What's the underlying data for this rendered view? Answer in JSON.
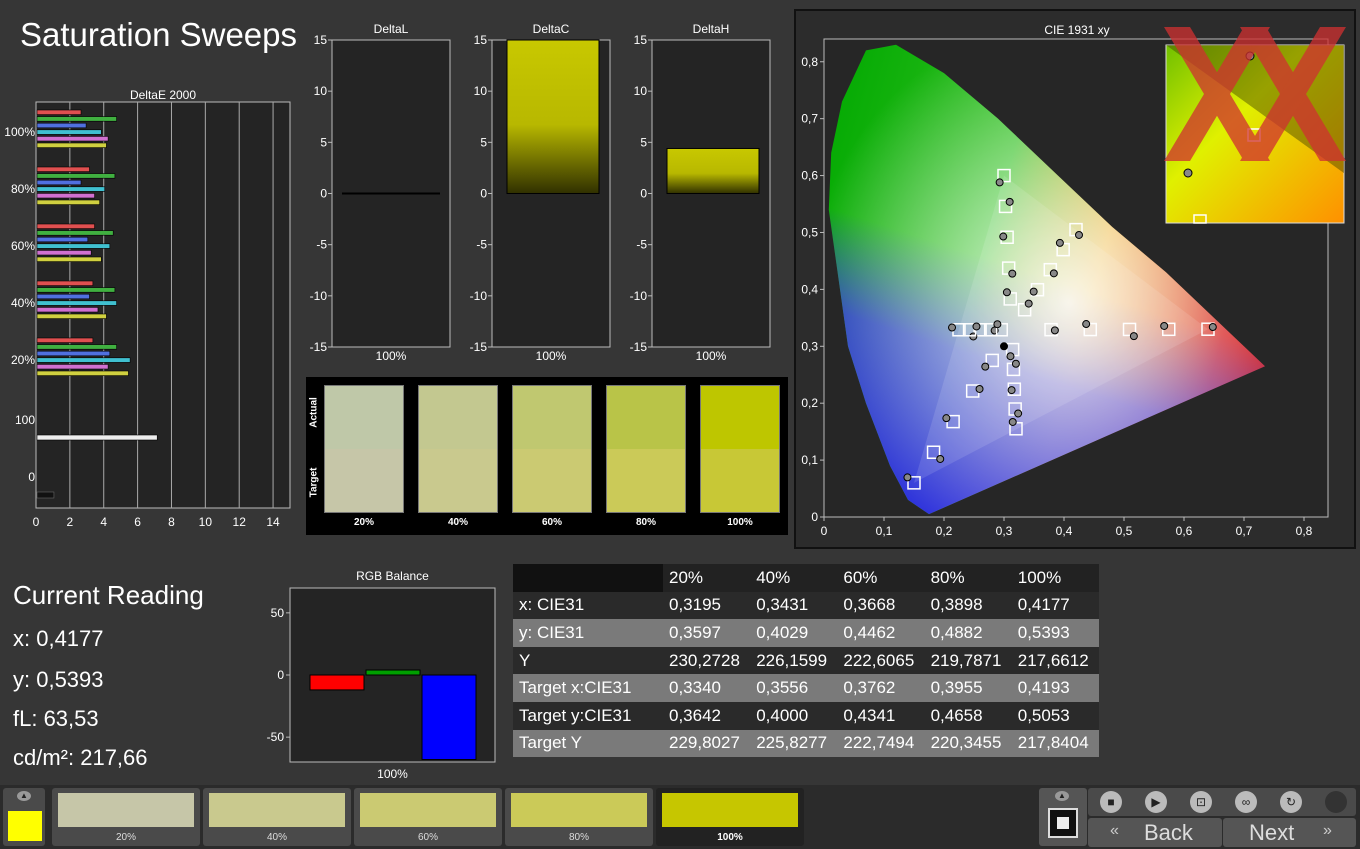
{
  "page_title": "Saturation Sweeps",
  "deltae": {
    "title": "DeltaE 2000",
    "y_labels": [
      "100%",
      "80%",
      "60%",
      "40%",
      "20%",
      "100",
      "0"
    ],
    "x_ticks": [
      "0",
      "2",
      "4",
      "6",
      "8",
      "10",
      "12",
      "14"
    ],
    "groups": [
      {
        "label": "100%",
        "values": [
          2.6,
          4.7,
          2.9,
          3.8,
          4.2,
          4.1
        ]
      },
      {
        "label": "80%",
        "values": [
          3.1,
          4.6,
          2.6,
          4.0,
          3.4,
          3.7
        ]
      },
      {
        "label": "60%",
        "values": [
          3.4,
          4.5,
          3.0,
          4.3,
          3.2,
          3.8
        ]
      },
      {
        "label": "40%",
        "values": [
          3.3,
          4.6,
          3.1,
          4.7,
          3.6,
          4.1
        ]
      },
      {
        "label": "20%",
        "values": [
          3.3,
          4.7,
          4.3,
          5.5,
          4.2,
          5.4
        ]
      }
    ],
    "white_value": 7.1,
    "black_value": 1.0,
    "colors": [
      "#e05050",
      "#40b040",
      "#5070e0",
      "#40c0d0",
      "#d070d0",
      "#d0d040"
    ]
  },
  "delta_charts": [
    {
      "title": "DeltaL",
      "value": 0,
      "label": "100%"
    },
    {
      "title": "DeltaC",
      "value": 15,
      "label": "100%"
    },
    {
      "title": "DeltaH",
      "value": 4.4,
      "label": "100%"
    }
  ],
  "delta_y_ticks": [
    "15",
    "10",
    "5",
    "0",
    "-5",
    "-10",
    "-15"
  ],
  "patches": {
    "row_labels": [
      "Actual",
      "Target"
    ],
    "items": [
      {
        "label": "20%",
        "actual": "#bfc8a8",
        "target": "#c6c6a8"
      },
      {
        "label": "40%",
        "actual": "#c3c890",
        "target": "#c9c98e"
      },
      {
        "label": "60%",
        "actual": "#c0c870",
        "target": "#cbca72"
      },
      {
        "label": "80%",
        "actual": "#b9c448",
        "target": "#cbca58"
      },
      {
        "label": "100%",
        "actual": "#bec600",
        "target": "#c8c836"
      }
    ]
  },
  "cie": {
    "title": "CIE 1931 xy",
    "x_ticks": [
      "0",
      "0,1",
      "0,2",
      "0,3",
      "0,4",
      "0,5",
      "0,6",
      "0,7",
      "0,8"
    ],
    "y_ticks": [
      "0",
      "0,1",
      "0,2",
      "0,3",
      "0,4",
      "0,5",
      "0,6",
      "0,7",
      "0,8"
    ]
  },
  "current": {
    "heading": "Current Reading",
    "x": "x: 0,4177",
    "y": "y: 0,5393",
    "fl": "fL: 63,53",
    "cdm": "cd/m²: 217,66"
  },
  "rgb": {
    "title": "RGB Balance",
    "y_ticks": [
      "50",
      "0",
      "-50"
    ],
    "label": "100%",
    "values": {
      "r": -12,
      "g": 4,
      "b": -68
    }
  },
  "table": {
    "headers": [
      "",
      "20%",
      "40%",
      "60%",
      "80%",
      "100%"
    ],
    "rows": [
      [
        "x: CIE31",
        "0,3195",
        "0,3431",
        "0,3668",
        "0,3898",
        "0,4177"
      ],
      [
        "y: CIE31",
        "0,3597",
        "0,4029",
        "0,4462",
        "0,4882",
        "0,5393"
      ],
      [
        "Y",
        "230,2728",
        "226,1599",
        "222,6065",
        "219,7871",
        "217,6612"
      ],
      [
        "Target x:CIE31",
        "0,3340",
        "0,3556",
        "0,3762",
        "0,3955",
        "0,4193"
      ],
      [
        "Target y:CIE31",
        "0,3642",
        "0,4000",
        "0,4341",
        "0,4658",
        "0,5053"
      ],
      [
        "Target Y",
        "229,8027",
        "225,8277",
        "222,7494",
        "220,3455",
        "217,8404"
      ]
    ]
  },
  "bottom": {
    "swatches": [
      {
        "label": "20%",
        "color": "#c6c6a8"
      },
      {
        "label": "40%",
        "color": "#c9c98e"
      },
      {
        "label": "60%",
        "color": "#cbca72"
      },
      {
        "label": "80%",
        "color": "#cbca58"
      },
      {
        "label": "100%",
        "color": "#c6c600"
      }
    ],
    "current_color": "#ffff00",
    "back_label": "Back",
    "next_label": "Next"
  }
}
